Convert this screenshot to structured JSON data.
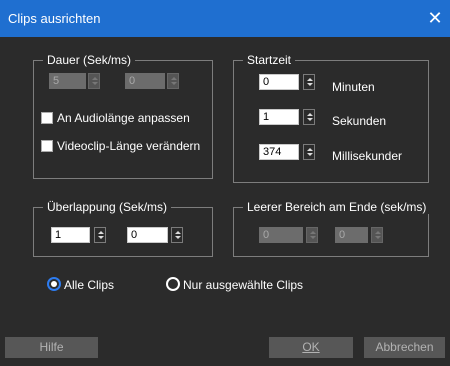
{
  "window": {
    "title": "Clips ausrichten",
    "close_glyph": "✕"
  },
  "duration": {
    "legend": "Dauer (Sek/ms)",
    "seconds_value": "5",
    "ms_value": "0",
    "checkbox_audio": "An Audiolänge anpassen",
    "checkbox_video": "Videoclip-Länge verändern"
  },
  "start": {
    "legend": "Startzeit",
    "minutes_value": "0",
    "minutes_label": "Minuten",
    "seconds_value": "1",
    "seconds_label": "Sekunden",
    "ms_value": "374",
    "ms_label": "Millisekunder"
  },
  "overlap": {
    "legend": "Überlappung (Sek/ms)",
    "seconds_value": "1",
    "ms_value": "0"
  },
  "empty_end": {
    "legend": "Leerer Bereich am Ende (sek/ms)",
    "seconds_value": "0",
    "ms_value": "0"
  },
  "radios": {
    "all_clips": "Alle Clips",
    "selected_clips": "Nur ausgewählte Clips"
  },
  "buttons": {
    "help": "Hilfe",
    "ok": "OK",
    "cancel": "Abbrechen"
  },
  "colors": {
    "titlebar": "#1f6fd0",
    "dialog_bg": "#2b2b2b",
    "radio_accent": "#2d7cf0"
  },
  "icons": {
    "spin": "spin-up-down-icon",
    "close": "close-icon"
  }
}
